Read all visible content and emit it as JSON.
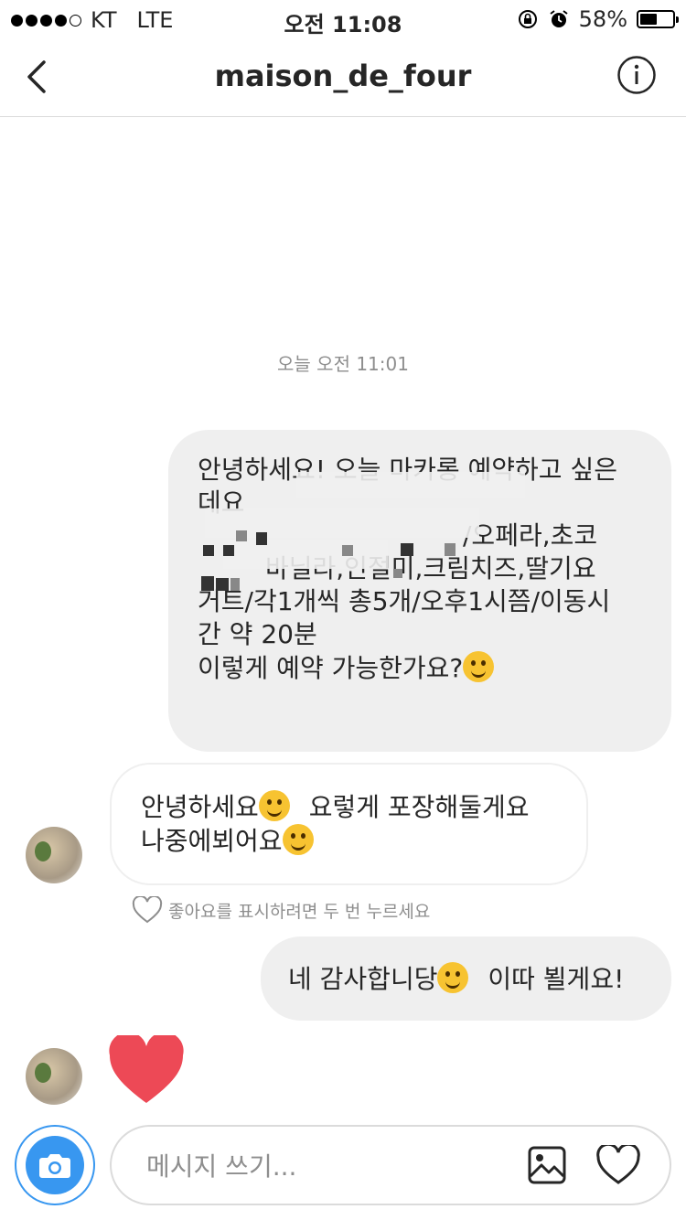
{
  "status_bar": {
    "carrier": "KT",
    "network": "LTE",
    "time": "오전 11:08",
    "battery_percent": "58%",
    "battery_level": 0.58,
    "signal_bars_filled": 4,
    "signal_bars_total": 5
  },
  "header": {
    "title": "maison_de_four",
    "icons": {
      "back": "chevron-left-icon",
      "info": "info-icon"
    }
  },
  "conversation": {
    "timestamp": "오늘 오전 11:01",
    "messages": [
      {
        "sender": "me",
        "lines": [
          "안녕하세요! 오늘 마카롱 예약하고 싶은",
          "데요",
          "/오페라,초코",
          "바닐라,인절미,크림치즈,딸기요",
          "거트/각1개씩 총5개/오후1시쯤/이동시",
          "간 약 20분",
          "이렇게 예약 가능한가요?"
        ],
        "trailing_emoji": "smiling-face-icon"
      },
      {
        "sender": "them",
        "line1": "안녕하세요",
        "line1_after": "요렇게 포장해둘게요",
        "line2": "나중에뵈어요",
        "emojis": [
          "smiling-face-icon",
          "grinning-face-icon"
        ]
      },
      {
        "sender": "them",
        "type": "like-hint",
        "text": "좋아요를 표시하려면 두 번 누르세요"
      },
      {
        "sender": "me",
        "before": "네 감사합니당",
        "after": "이따 뵐게요!",
        "emoji": "laughing-face-icon"
      },
      {
        "sender": "them",
        "type": "heart",
        "icon": "heart-icon",
        "color": "#ed4956"
      }
    ]
  },
  "composer": {
    "placeholder": "메시지 쓰기...",
    "icons": {
      "camera": "camera-icon",
      "gallery": "image-icon",
      "like": "heart-outline-icon"
    }
  },
  "colors": {
    "accent": "#3897f0",
    "bubble_out": "#efefef",
    "heart": "#ed4956",
    "meta_text": "#8e8e8e"
  }
}
